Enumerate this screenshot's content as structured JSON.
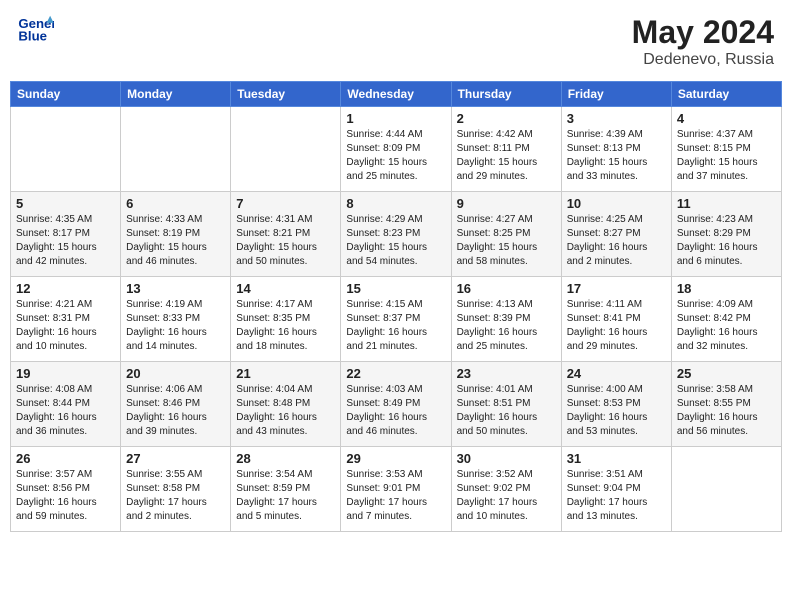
{
  "header": {
    "logo_line1": "General",
    "logo_line2": "Blue",
    "month": "May 2024",
    "location": "Dedenevo, Russia"
  },
  "weekdays": [
    "Sunday",
    "Monday",
    "Tuesday",
    "Wednesday",
    "Thursday",
    "Friday",
    "Saturday"
  ],
  "weeks": [
    [
      {
        "day": "",
        "sunrise": "",
        "sunset": "",
        "daylight": ""
      },
      {
        "day": "",
        "sunrise": "",
        "sunset": "",
        "daylight": ""
      },
      {
        "day": "",
        "sunrise": "",
        "sunset": "",
        "daylight": ""
      },
      {
        "day": "1",
        "sunrise": "Sunrise: 4:44 AM",
        "sunset": "Sunset: 8:09 PM",
        "daylight": "Daylight: 15 hours and 25 minutes."
      },
      {
        "day": "2",
        "sunrise": "Sunrise: 4:42 AM",
        "sunset": "Sunset: 8:11 PM",
        "daylight": "Daylight: 15 hours and 29 minutes."
      },
      {
        "day": "3",
        "sunrise": "Sunrise: 4:39 AM",
        "sunset": "Sunset: 8:13 PM",
        "daylight": "Daylight: 15 hours and 33 minutes."
      },
      {
        "day": "4",
        "sunrise": "Sunrise: 4:37 AM",
        "sunset": "Sunset: 8:15 PM",
        "daylight": "Daylight: 15 hours and 37 minutes."
      }
    ],
    [
      {
        "day": "5",
        "sunrise": "Sunrise: 4:35 AM",
        "sunset": "Sunset: 8:17 PM",
        "daylight": "Daylight: 15 hours and 42 minutes."
      },
      {
        "day": "6",
        "sunrise": "Sunrise: 4:33 AM",
        "sunset": "Sunset: 8:19 PM",
        "daylight": "Daylight: 15 hours and 46 minutes."
      },
      {
        "day": "7",
        "sunrise": "Sunrise: 4:31 AM",
        "sunset": "Sunset: 8:21 PM",
        "daylight": "Daylight: 15 hours and 50 minutes."
      },
      {
        "day": "8",
        "sunrise": "Sunrise: 4:29 AM",
        "sunset": "Sunset: 8:23 PM",
        "daylight": "Daylight: 15 hours and 54 minutes."
      },
      {
        "day": "9",
        "sunrise": "Sunrise: 4:27 AM",
        "sunset": "Sunset: 8:25 PM",
        "daylight": "Daylight: 15 hours and 58 minutes."
      },
      {
        "day": "10",
        "sunrise": "Sunrise: 4:25 AM",
        "sunset": "Sunset: 8:27 PM",
        "daylight": "Daylight: 16 hours and 2 minutes."
      },
      {
        "day": "11",
        "sunrise": "Sunrise: 4:23 AM",
        "sunset": "Sunset: 8:29 PM",
        "daylight": "Daylight: 16 hours and 6 minutes."
      }
    ],
    [
      {
        "day": "12",
        "sunrise": "Sunrise: 4:21 AM",
        "sunset": "Sunset: 8:31 PM",
        "daylight": "Daylight: 16 hours and 10 minutes."
      },
      {
        "day": "13",
        "sunrise": "Sunrise: 4:19 AM",
        "sunset": "Sunset: 8:33 PM",
        "daylight": "Daylight: 16 hours and 14 minutes."
      },
      {
        "day": "14",
        "sunrise": "Sunrise: 4:17 AM",
        "sunset": "Sunset: 8:35 PM",
        "daylight": "Daylight: 16 hours and 18 minutes."
      },
      {
        "day": "15",
        "sunrise": "Sunrise: 4:15 AM",
        "sunset": "Sunset: 8:37 PM",
        "daylight": "Daylight: 16 hours and 21 minutes."
      },
      {
        "day": "16",
        "sunrise": "Sunrise: 4:13 AM",
        "sunset": "Sunset: 8:39 PM",
        "daylight": "Daylight: 16 hours and 25 minutes."
      },
      {
        "day": "17",
        "sunrise": "Sunrise: 4:11 AM",
        "sunset": "Sunset: 8:41 PM",
        "daylight": "Daylight: 16 hours and 29 minutes."
      },
      {
        "day": "18",
        "sunrise": "Sunrise: 4:09 AM",
        "sunset": "Sunset: 8:42 PM",
        "daylight": "Daylight: 16 hours and 32 minutes."
      }
    ],
    [
      {
        "day": "19",
        "sunrise": "Sunrise: 4:08 AM",
        "sunset": "Sunset: 8:44 PM",
        "daylight": "Daylight: 16 hours and 36 minutes."
      },
      {
        "day": "20",
        "sunrise": "Sunrise: 4:06 AM",
        "sunset": "Sunset: 8:46 PM",
        "daylight": "Daylight: 16 hours and 39 minutes."
      },
      {
        "day": "21",
        "sunrise": "Sunrise: 4:04 AM",
        "sunset": "Sunset: 8:48 PM",
        "daylight": "Daylight: 16 hours and 43 minutes."
      },
      {
        "day": "22",
        "sunrise": "Sunrise: 4:03 AM",
        "sunset": "Sunset: 8:49 PM",
        "daylight": "Daylight: 16 hours and 46 minutes."
      },
      {
        "day": "23",
        "sunrise": "Sunrise: 4:01 AM",
        "sunset": "Sunset: 8:51 PM",
        "daylight": "Daylight: 16 hours and 50 minutes."
      },
      {
        "day": "24",
        "sunrise": "Sunrise: 4:00 AM",
        "sunset": "Sunset: 8:53 PM",
        "daylight": "Daylight: 16 hours and 53 minutes."
      },
      {
        "day": "25",
        "sunrise": "Sunrise: 3:58 AM",
        "sunset": "Sunset: 8:55 PM",
        "daylight": "Daylight: 16 hours and 56 minutes."
      }
    ],
    [
      {
        "day": "26",
        "sunrise": "Sunrise: 3:57 AM",
        "sunset": "Sunset: 8:56 PM",
        "daylight": "Daylight: 16 hours and 59 minutes."
      },
      {
        "day": "27",
        "sunrise": "Sunrise: 3:55 AM",
        "sunset": "Sunset: 8:58 PM",
        "daylight": "Daylight: 17 hours and 2 minutes."
      },
      {
        "day": "28",
        "sunrise": "Sunrise: 3:54 AM",
        "sunset": "Sunset: 8:59 PM",
        "daylight": "Daylight: 17 hours and 5 minutes."
      },
      {
        "day": "29",
        "sunrise": "Sunrise: 3:53 AM",
        "sunset": "Sunset: 9:01 PM",
        "daylight": "Daylight: 17 hours and 7 minutes."
      },
      {
        "day": "30",
        "sunrise": "Sunrise: 3:52 AM",
        "sunset": "Sunset: 9:02 PM",
        "daylight": "Daylight: 17 hours and 10 minutes."
      },
      {
        "day": "31",
        "sunrise": "Sunrise: 3:51 AM",
        "sunset": "Sunset: 9:04 PM",
        "daylight": "Daylight: 17 hours and 13 minutes."
      },
      {
        "day": "",
        "sunrise": "",
        "sunset": "",
        "daylight": ""
      }
    ]
  ]
}
